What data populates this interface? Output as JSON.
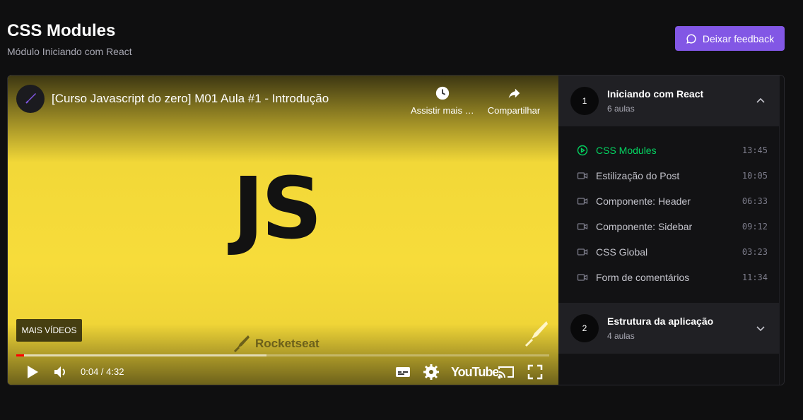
{
  "page": {
    "title": "CSS Modules",
    "subtitle": "Módulo Iniciando com React"
  },
  "feedback_button": {
    "label": "Deixar feedback",
    "icon": "chat-bubble-icon"
  },
  "video": {
    "title": "[Curso Javascript do zero] M01 Aula #1 - Introdução",
    "logo_text": "JS",
    "watch_later_label": "Assistir mais tarde",
    "share_label": "Compartilhar",
    "more_videos_label": "MAIS VÍDEOS",
    "watermark": "Rocketseat",
    "time": "0:04 / 4:32",
    "progress_played": 0.015,
    "progress_buffered": 0.47,
    "youtube_label": "YouTube",
    "colors": {
      "background": "#f5d93b",
      "progress": "#ff0000"
    }
  },
  "sidebar": {
    "modules": [
      {
        "number": "1",
        "title": "Iniciando com React",
        "count": "6 aulas",
        "expanded": true,
        "lessons": [
          {
            "name": "CSS Modules",
            "duration": "13:45",
            "active": true
          },
          {
            "name": "Estilização do Post",
            "duration": "10:05"
          },
          {
            "name": "Componente: Header",
            "duration": "06:33"
          },
          {
            "name": "Componente: Sidebar",
            "duration": "09:12"
          },
          {
            "name": "CSS Global",
            "duration": "03:23"
          },
          {
            "name": "Form de comentários",
            "duration": "11:34"
          }
        ]
      },
      {
        "number": "2",
        "title": "Estrutura da aplicação",
        "count": "4 aulas",
        "expanded": false
      }
    ]
  },
  "colors": {
    "accent": "#8257e5",
    "active_lesson": "#04d361"
  }
}
